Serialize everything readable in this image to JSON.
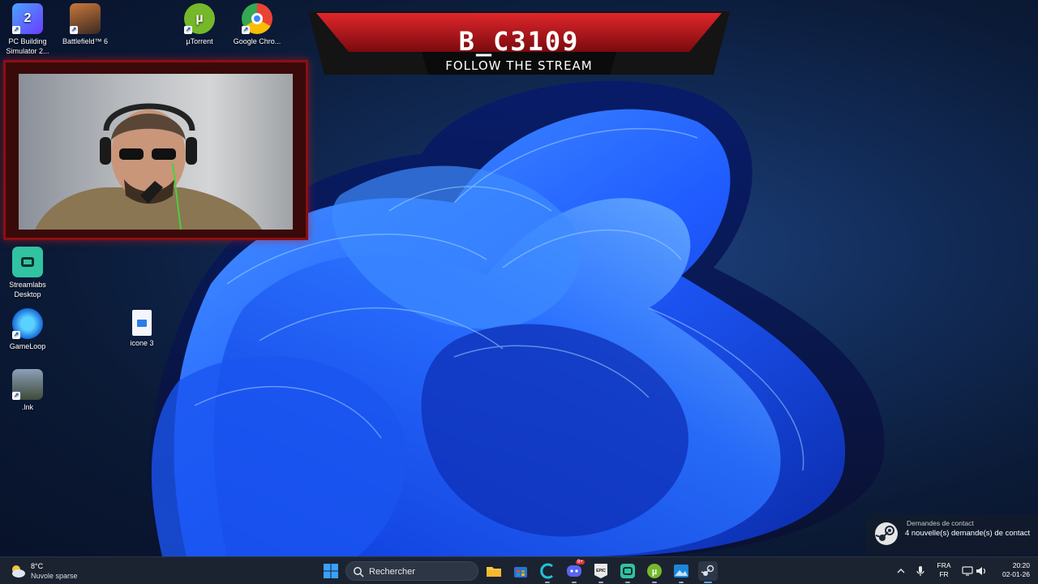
{
  "desktop": {
    "icons": [
      {
        "label": "PC Building Simulator 2...",
        "icon": "pc-building-simulator-icon"
      },
      {
        "label": "Battlefield™ 6",
        "icon": "battlefield-icon"
      },
      {
        "label": "µTorrent",
        "icon": "utorrent-icon"
      },
      {
        "label": "Google Chro...",
        "icon": "chrome-icon"
      },
      {
        "label": "Streamlabs Desktop",
        "icon": "streamlabs-icon"
      },
      {
        "label": "GameLoop",
        "icon": "gameloop-icon"
      },
      {
        "label": "icone 3",
        "icon": "file-icon"
      },
      {
        "label": ".lnk",
        "icon": "pubg-shortcut-icon"
      }
    ]
  },
  "overlay": {
    "channel_name": "B_C3109",
    "tagline": "FOLLOW THE STREAM"
  },
  "notification": {
    "title": "Demandes de contact",
    "body": "4 nouvelle(s) demande(s) de contact",
    "icon": "steam-icon"
  },
  "taskbar": {
    "weather": {
      "temp": "8°C",
      "desc": "Nuvole sparse"
    },
    "search_placeholder": "Rechercher",
    "apps": [
      "file-explorer-icon",
      "microsoft-store-icon",
      "gameloop-icon",
      "discord-icon",
      "epic-games-icon",
      "streamlabs-icon",
      "utorrent-icon",
      "photos-icon",
      "steam-icon"
    ],
    "discord_badge": "9+",
    "lang_top": "FRA",
    "lang_bottom": "FR",
    "time": "20:20",
    "date": "02-01-26"
  },
  "colors": {
    "accent_red": "#b1141a",
    "taskbar": "#1b2330",
    "wallpaper_blue": "#1f5bff"
  }
}
